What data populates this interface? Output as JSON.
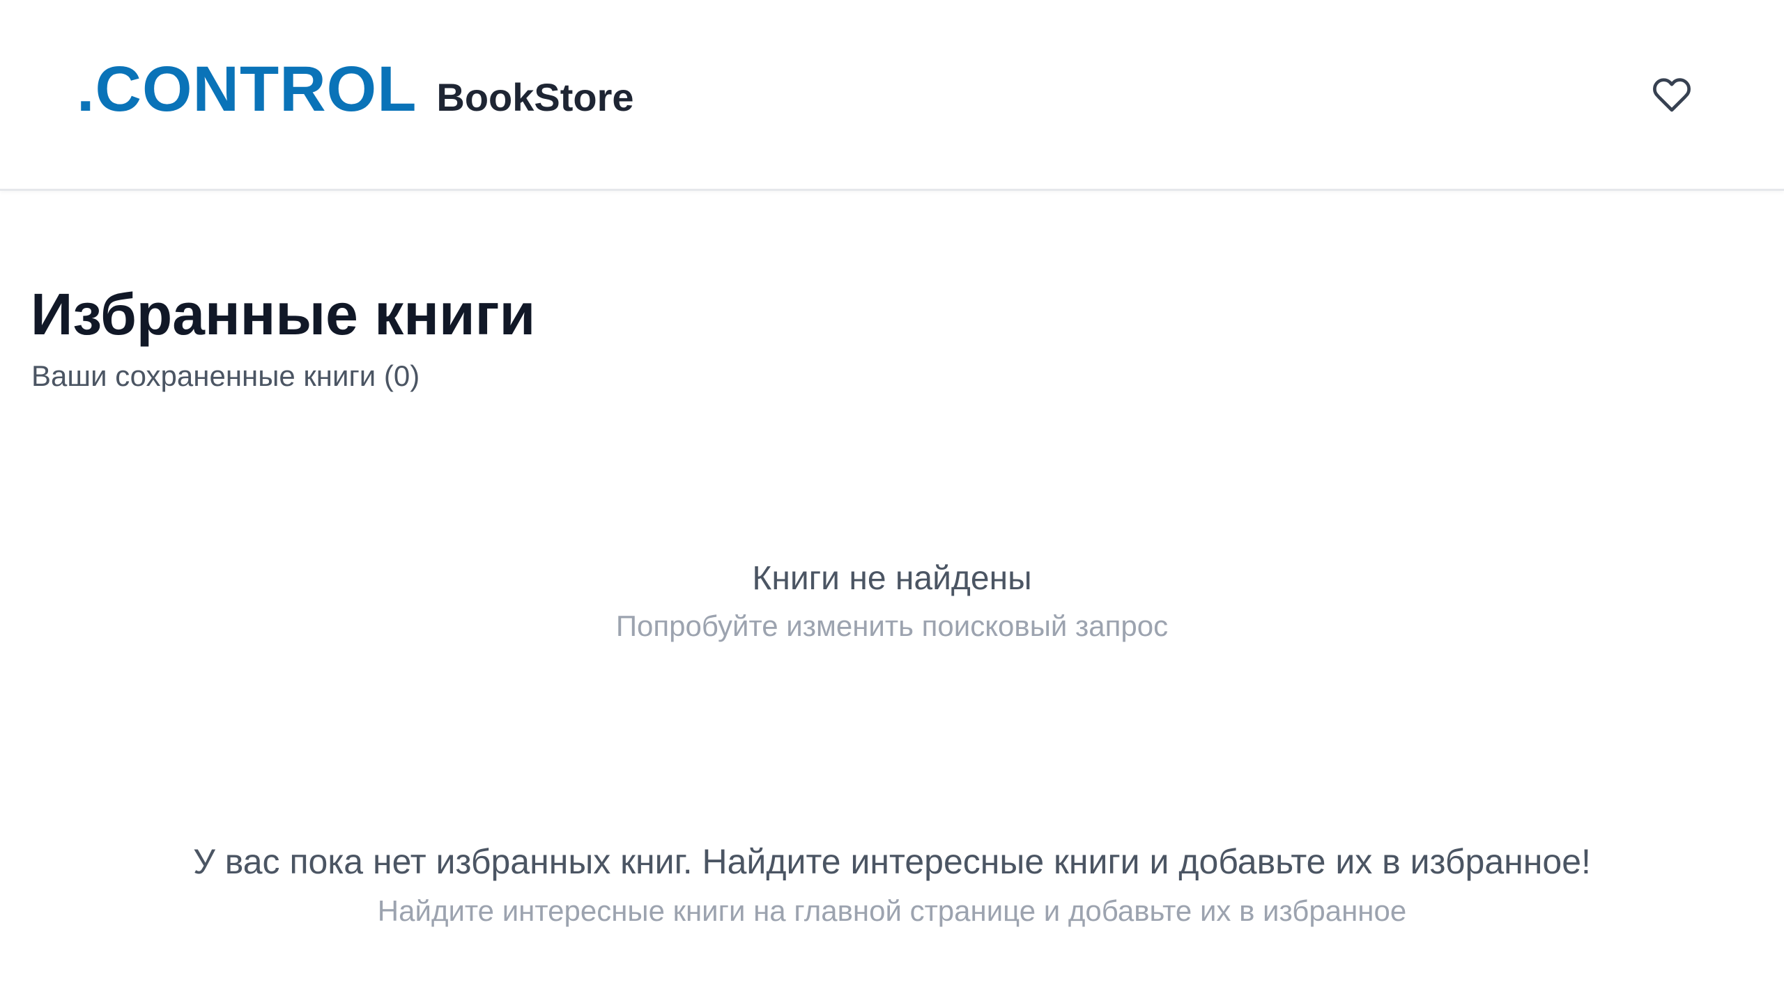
{
  "header": {
    "logo_mark": ".CONTROL",
    "logo_name": "BookStore",
    "favorites_icon": "heart-outline-icon",
    "brand_color": "#0a73b8"
  },
  "page": {
    "title": "Избранные книги",
    "subtitle": "Ваши сохраненные книги (0)"
  },
  "search_empty": {
    "title": "Книги не найдены",
    "hint": "Попробуйте изменить поисковый запрос"
  },
  "favorites_empty": {
    "message": "У вас пока нет избранных книг. Найдите интересные книги и добавьте их в избранное!",
    "hint": "Найдите интересные книги на главной странице и добавьте их в избранное"
  }
}
